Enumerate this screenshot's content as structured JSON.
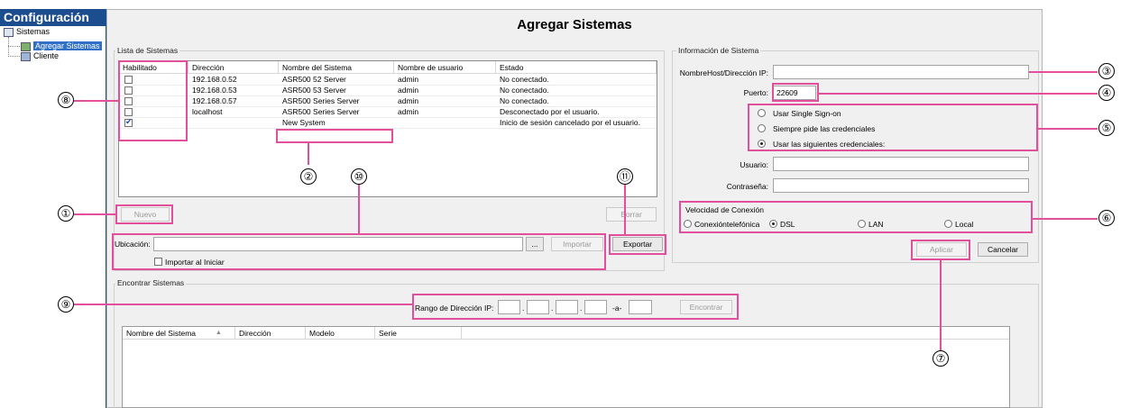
{
  "tree": {
    "title": "Configuración",
    "items": [
      {
        "label": "Sistemas"
      },
      {
        "label": "Agregar Sistemas"
      },
      {
        "label": "Cliente"
      }
    ]
  },
  "page_title": "Agregar Sistemas",
  "system_list": {
    "group_title": "Lista de Sistemas",
    "columns": [
      "Habilitado",
      "Dirección",
      "Nombre del Sistema",
      "Nombre de usuario",
      "Estado"
    ],
    "rows": [
      {
        "enabled": false,
        "address": "192.168.0.52",
        "name": "ASR500 52 Server",
        "user": "admin",
        "status": "No conectado."
      },
      {
        "enabled": false,
        "address": "192.168.0.53",
        "name": "ASR500 53 Server",
        "user": "admin",
        "status": "No conectado."
      },
      {
        "enabled": false,
        "address": "192.168.0.57",
        "name": "ASR500 Series Server",
        "user": "admin",
        "status": "No conectado."
      },
      {
        "enabled": false,
        "address": "localhost",
        "name": "ASR500 Series Server",
        "user": "admin",
        "status": "Desconectado por el usuario."
      },
      {
        "enabled": true,
        "address": "",
        "name": "New System",
        "user": "",
        "status": "Inicio de sesión cancelado por el usuario."
      }
    ],
    "new_button": "Nuevo",
    "delete_button": "Borrar",
    "location_label": "Ubicación:",
    "location_value": "",
    "browse_button": "...",
    "import_button": "Importar",
    "export_button": "Exportar",
    "import_on_start_label": "Importar al Iniciar"
  },
  "system_info": {
    "group_title": "Información de Sistema",
    "host_label": "NombreHost/Dirección IP:",
    "host_value": "",
    "port_label": "Puerto:",
    "port_value": "22609",
    "auth_options": [
      {
        "label": "Usar Single Sign-on",
        "selected": false
      },
      {
        "label": "Siempre pide las credenciales",
        "selected": false
      },
      {
        "label": "Usar las siguientes credenciales:",
        "selected": true
      }
    ],
    "user_label": "Usuario:",
    "user_value": "",
    "password_label": "Contraseña:",
    "password_value": "",
    "speed_title": "Velocidad de Conexión",
    "speed_options": [
      {
        "label": "Conexióntelefónica",
        "selected": false
      },
      {
        "label": "DSL",
        "selected": true
      },
      {
        "label": "LAN",
        "selected": false
      },
      {
        "label": "Local",
        "selected": false
      }
    ],
    "apply_button": "Aplicar",
    "cancel_button": "Cancelar"
  },
  "find_systems": {
    "group_title": "Encontrar Sistemas",
    "range_label": "Rango de Dirección IP:",
    "separator": "-a-",
    "find_button": "Encontrar",
    "columns": [
      "Nombre del Sistema",
      "Dirección",
      "Modelo",
      "Serie"
    ],
    "sort_indicator": "▲"
  },
  "callouts": [
    "①",
    "②",
    "③",
    "④",
    "⑤",
    "⑥",
    "⑦",
    "⑧",
    "⑨",
    "⑩",
    "⑪"
  ],
  "colors": {
    "highlight": "#e2509c",
    "tree_header": "#1c4d8f",
    "selection": "#3170c6"
  }
}
